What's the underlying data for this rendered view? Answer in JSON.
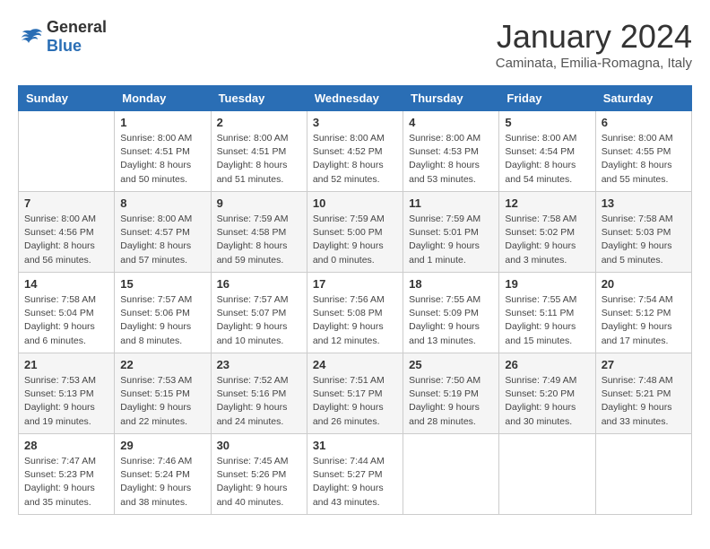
{
  "logo": {
    "general": "General",
    "blue": "Blue"
  },
  "title": "January 2024",
  "subtitle": "Caminata, Emilia-Romagna, Italy",
  "days_of_week": [
    "Sunday",
    "Monday",
    "Tuesday",
    "Wednesday",
    "Thursday",
    "Friday",
    "Saturday"
  ],
  "weeks": [
    [
      {
        "day": "",
        "info": ""
      },
      {
        "day": "1",
        "info": "Sunrise: 8:00 AM\nSunset: 4:51 PM\nDaylight: 8 hours\nand 50 minutes."
      },
      {
        "day": "2",
        "info": "Sunrise: 8:00 AM\nSunset: 4:51 PM\nDaylight: 8 hours\nand 51 minutes."
      },
      {
        "day": "3",
        "info": "Sunrise: 8:00 AM\nSunset: 4:52 PM\nDaylight: 8 hours\nand 52 minutes."
      },
      {
        "day": "4",
        "info": "Sunrise: 8:00 AM\nSunset: 4:53 PM\nDaylight: 8 hours\nand 53 minutes."
      },
      {
        "day": "5",
        "info": "Sunrise: 8:00 AM\nSunset: 4:54 PM\nDaylight: 8 hours\nand 54 minutes."
      },
      {
        "day": "6",
        "info": "Sunrise: 8:00 AM\nSunset: 4:55 PM\nDaylight: 8 hours\nand 55 minutes."
      }
    ],
    [
      {
        "day": "7",
        "info": "Sunrise: 8:00 AM\nSunset: 4:56 PM\nDaylight: 8 hours\nand 56 minutes."
      },
      {
        "day": "8",
        "info": "Sunrise: 8:00 AM\nSunset: 4:57 PM\nDaylight: 8 hours\nand 57 minutes."
      },
      {
        "day": "9",
        "info": "Sunrise: 7:59 AM\nSunset: 4:58 PM\nDaylight: 8 hours\nand 59 minutes."
      },
      {
        "day": "10",
        "info": "Sunrise: 7:59 AM\nSunset: 5:00 PM\nDaylight: 9 hours\nand 0 minutes."
      },
      {
        "day": "11",
        "info": "Sunrise: 7:59 AM\nSunset: 5:01 PM\nDaylight: 9 hours\nand 1 minute."
      },
      {
        "day": "12",
        "info": "Sunrise: 7:58 AM\nSunset: 5:02 PM\nDaylight: 9 hours\nand 3 minutes."
      },
      {
        "day": "13",
        "info": "Sunrise: 7:58 AM\nSunset: 5:03 PM\nDaylight: 9 hours\nand 5 minutes."
      }
    ],
    [
      {
        "day": "14",
        "info": "Sunrise: 7:58 AM\nSunset: 5:04 PM\nDaylight: 9 hours\nand 6 minutes."
      },
      {
        "day": "15",
        "info": "Sunrise: 7:57 AM\nSunset: 5:06 PM\nDaylight: 9 hours\nand 8 minutes."
      },
      {
        "day": "16",
        "info": "Sunrise: 7:57 AM\nSunset: 5:07 PM\nDaylight: 9 hours\nand 10 minutes."
      },
      {
        "day": "17",
        "info": "Sunrise: 7:56 AM\nSunset: 5:08 PM\nDaylight: 9 hours\nand 12 minutes."
      },
      {
        "day": "18",
        "info": "Sunrise: 7:55 AM\nSunset: 5:09 PM\nDaylight: 9 hours\nand 13 minutes."
      },
      {
        "day": "19",
        "info": "Sunrise: 7:55 AM\nSunset: 5:11 PM\nDaylight: 9 hours\nand 15 minutes."
      },
      {
        "day": "20",
        "info": "Sunrise: 7:54 AM\nSunset: 5:12 PM\nDaylight: 9 hours\nand 17 minutes."
      }
    ],
    [
      {
        "day": "21",
        "info": "Sunrise: 7:53 AM\nSunset: 5:13 PM\nDaylight: 9 hours\nand 19 minutes."
      },
      {
        "day": "22",
        "info": "Sunrise: 7:53 AM\nSunset: 5:15 PM\nDaylight: 9 hours\nand 22 minutes."
      },
      {
        "day": "23",
        "info": "Sunrise: 7:52 AM\nSunset: 5:16 PM\nDaylight: 9 hours\nand 24 minutes."
      },
      {
        "day": "24",
        "info": "Sunrise: 7:51 AM\nSunset: 5:17 PM\nDaylight: 9 hours\nand 26 minutes."
      },
      {
        "day": "25",
        "info": "Sunrise: 7:50 AM\nSunset: 5:19 PM\nDaylight: 9 hours\nand 28 minutes."
      },
      {
        "day": "26",
        "info": "Sunrise: 7:49 AM\nSunset: 5:20 PM\nDaylight: 9 hours\nand 30 minutes."
      },
      {
        "day": "27",
        "info": "Sunrise: 7:48 AM\nSunset: 5:21 PM\nDaylight: 9 hours\nand 33 minutes."
      }
    ],
    [
      {
        "day": "28",
        "info": "Sunrise: 7:47 AM\nSunset: 5:23 PM\nDaylight: 9 hours\nand 35 minutes."
      },
      {
        "day": "29",
        "info": "Sunrise: 7:46 AM\nSunset: 5:24 PM\nDaylight: 9 hours\nand 38 minutes."
      },
      {
        "day": "30",
        "info": "Sunrise: 7:45 AM\nSunset: 5:26 PM\nDaylight: 9 hours\nand 40 minutes."
      },
      {
        "day": "31",
        "info": "Sunrise: 7:44 AM\nSunset: 5:27 PM\nDaylight: 9 hours\nand 43 minutes."
      },
      {
        "day": "",
        "info": ""
      },
      {
        "day": "",
        "info": ""
      },
      {
        "day": "",
        "info": ""
      }
    ]
  ]
}
